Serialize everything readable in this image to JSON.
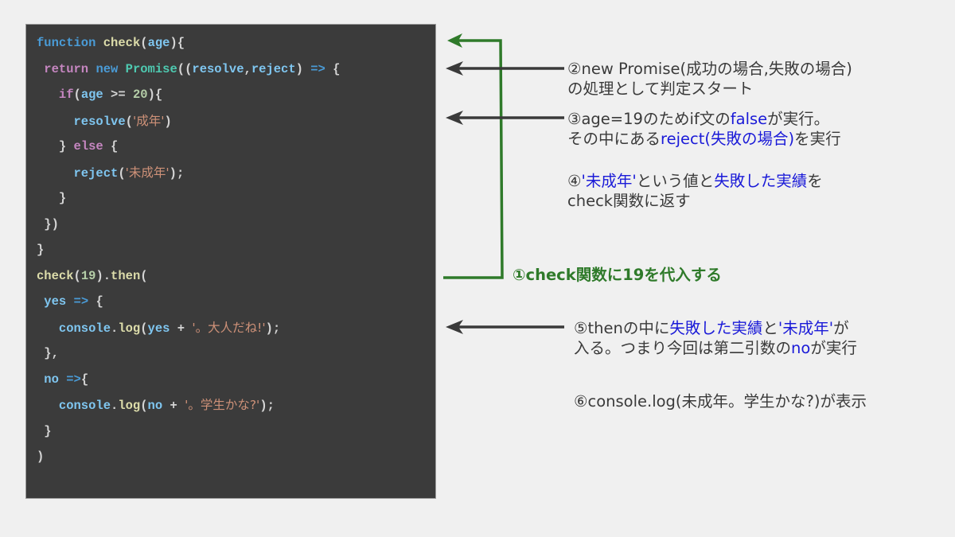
{
  "code": {
    "lines": [
      [
        {
          "t": "function",
          "c": "kw-blue"
        },
        {
          "t": " ",
          "c": "punc"
        },
        {
          "t": "check",
          "c": "fn"
        },
        {
          "t": "(",
          "c": "punc"
        },
        {
          "t": "age",
          "c": "var"
        },
        {
          "t": "){",
          "c": "punc"
        }
      ],
      [
        {
          "t": " return",
          "c": "kw-pink"
        },
        {
          "t": " ",
          "c": "punc"
        },
        {
          "t": "new",
          "c": "kw-blue"
        },
        {
          "t": " ",
          "c": "punc"
        },
        {
          "t": "Promise",
          "c": "cls"
        },
        {
          "t": "((",
          "c": "punc"
        },
        {
          "t": "resolve",
          "c": "var"
        },
        {
          "t": ",",
          "c": "punc"
        },
        {
          "t": "reject",
          "c": "var"
        },
        {
          "t": ") ",
          "c": "punc"
        },
        {
          "t": "=>",
          "c": "kw-blue"
        },
        {
          "t": " {",
          "c": "punc"
        }
      ],
      [
        {
          "t": "   if",
          "c": "kw-pink"
        },
        {
          "t": "(",
          "c": "punc"
        },
        {
          "t": "age",
          "c": "var"
        },
        {
          "t": " >= ",
          "c": "punc"
        },
        {
          "t": "20",
          "c": "num"
        },
        {
          "t": "){",
          "c": "punc"
        }
      ],
      [
        {
          "t": "     resolve",
          "c": "var"
        },
        {
          "t": "(",
          "c": "punc"
        },
        {
          "t": "'成年'",
          "c": "str jp"
        },
        {
          "t": ")",
          "c": "punc"
        }
      ],
      [
        {
          "t": "   } ",
          "c": "punc"
        },
        {
          "t": "else",
          "c": "kw-pink"
        },
        {
          "t": " {",
          "c": "punc"
        }
      ],
      [
        {
          "t": "     reject",
          "c": "var"
        },
        {
          "t": "(",
          "c": "punc"
        },
        {
          "t": "'未成年'",
          "c": "str jp"
        },
        {
          "t": ");",
          "c": "punc"
        }
      ],
      [
        {
          "t": "   }",
          "c": "punc"
        }
      ],
      [
        {
          "t": " })",
          "c": "punc"
        }
      ],
      [
        {
          "t": "}",
          "c": "punc"
        }
      ],
      [
        {
          "t": "check",
          "c": "fn"
        },
        {
          "t": "(",
          "c": "punc"
        },
        {
          "t": "19",
          "c": "num"
        },
        {
          "t": ").",
          "c": "punc"
        },
        {
          "t": "then",
          "c": "fn"
        },
        {
          "t": "(",
          "c": "punc"
        }
      ],
      [
        {
          "t": " yes",
          "c": "var"
        },
        {
          "t": " ",
          "c": "punc"
        },
        {
          "t": "=>",
          "c": "kw-blue"
        },
        {
          "t": " {",
          "c": "punc"
        }
      ],
      [
        {
          "t": "   console",
          "c": "var"
        },
        {
          "t": ".",
          "c": "punc"
        },
        {
          "t": "log",
          "c": "fn"
        },
        {
          "t": "(",
          "c": "punc"
        },
        {
          "t": "yes",
          "c": "var"
        },
        {
          "t": " + ",
          "c": "punc"
        },
        {
          "t": "'。大人だね!'",
          "c": "str jp"
        },
        {
          "t": ");",
          "c": "punc"
        }
      ],
      [
        {
          "t": " },",
          "c": "punc"
        }
      ],
      [
        {
          "t": " no",
          "c": "var"
        },
        {
          "t": " ",
          "c": "punc"
        },
        {
          "t": "=>",
          "c": "kw-blue"
        },
        {
          "t": "{",
          "c": "punc"
        }
      ],
      [
        {
          "t": "   console",
          "c": "var"
        },
        {
          "t": ".",
          "c": "punc"
        },
        {
          "t": "log",
          "c": "fn"
        },
        {
          "t": "(",
          "c": "punc"
        },
        {
          "t": "no",
          "c": "var"
        },
        {
          "t": " + ",
          "c": "punc"
        },
        {
          "t": "'。学生かな?'",
          "c": "str jp"
        },
        {
          "t": ");",
          "c": "punc"
        }
      ],
      [
        {
          "t": " }",
          "c": "punc"
        }
      ],
      [
        {
          "t": ")",
          "c": "punc"
        }
      ]
    ]
  },
  "notes": {
    "step1": {
      "text": "①check関数に19を代入する"
    },
    "step2": {
      "line1": "②new Promise(成功の場合,失敗の場合)",
      "line2": "の処理として判定スタート"
    },
    "step3": {
      "line1": [
        {
          "t": "③age=19のためif文の"
        },
        {
          "t": "false",
          "hl": true
        },
        {
          "t": "が実行。"
        }
      ],
      "line2": [
        {
          "t": "その中にある"
        },
        {
          "t": "reject(失敗の場合)",
          "hl": true
        },
        {
          "t": "を実行"
        }
      ]
    },
    "step4": {
      "line1": [
        {
          "t": "④"
        },
        {
          "t": "'未成年'",
          "hl": true
        },
        {
          "t": "という値と"
        },
        {
          "t": "失敗した実績",
          "hl": true
        },
        {
          "t": "を"
        }
      ],
      "line2": [
        {
          "t": "check関数に返す"
        }
      ]
    },
    "step5": {
      "line1": [
        {
          "t": "⑤thenの中に"
        },
        {
          "t": "失敗した実績",
          "hl": true
        },
        {
          "t": "と"
        },
        {
          "t": "'未成年'",
          "hl": true
        },
        {
          "t": "が"
        }
      ],
      "line2": [
        {
          "t": "入る。つまり今回は第二引数の"
        },
        {
          "t": "no",
          "hl": true
        },
        {
          "t": "が実行"
        }
      ]
    },
    "step6": {
      "text": "⑥console.log(未成年。学生かな?)が表示"
    }
  },
  "colors": {
    "arrow_dark": "#3a3a3a",
    "arrow_green": "#2f7a2a",
    "highlight": "#1a1ad8",
    "code_bg": "#3b3b3b",
    "page_bg": "#f0f0f0"
  }
}
